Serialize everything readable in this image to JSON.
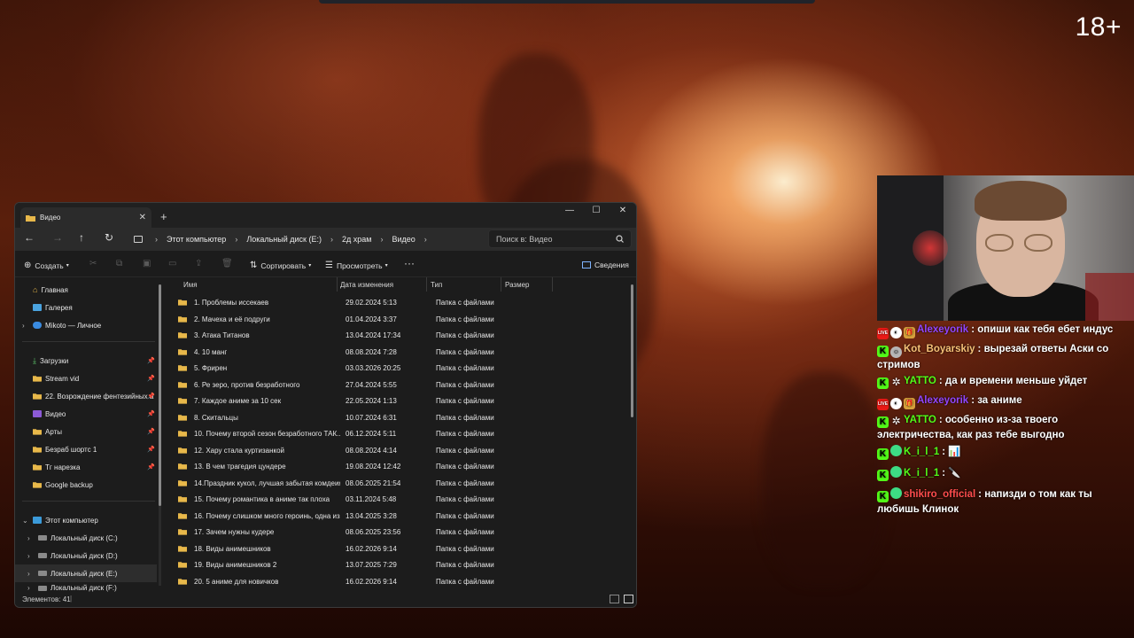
{
  "overlay": {
    "age_rating": "18+"
  },
  "explorer": {
    "tab_title": "Видео",
    "new_tab_symbol": "+",
    "window_controls": {
      "minimize": "—",
      "maximize": "☐",
      "close": "✕"
    },
    "nav": {
      "back": "←",
      "forward": "→",
      "up": "↑",
      "refresh": "↻"
    },
    "breadcrumbs": [
      "Этот компьютер",
      "Локальный диск (E:)",
      "2д храм",
      "Видео"
    ],
    "search_placeholder": "Поиск в: Видео",
    "toolbar": {
      "create": "Создать",
      "sort": "Сортировать",
      "view": "Просмотреть",
      "more": "···",
      "details": "Сведения"
    },
    "sidebar": {
      "quick": [
        "Главная",
        "Галерея",
        "Mikoto — Личное"
      ],
      "pinned": [
        "Загрузки",
        "Stream vid",
        "22. Возрождение фентезийных а",
        "Видео",
        "Арты",
        "Безраб шортс 1",
        "Тг нарезка",
        "Google backup"
      ],
      "this_pc": "Этот компьютер",
      "drives": [
        "Локальный диск (C:)",
        "Локальный диск (D:)",
        "Локальный диск (E:)",
        "Локальный диск (F:)"
      ]
    },
    "columns": {
      "name": "Имя",
      "date": "Дата изменения",
      "type": "Тип",
      "size": "Размер"
    },
    "files": [
      {
        "name": "1. Проблемы иссекаев",
        "date": "29.02.2024 5:13",
        "type": "Папка с файлами"
      },
      {
        "name": "2. Мачеха и её подруги",
        "date": "01.04.2024 3:37",
        "type": "Папка с файлами"
      },
      {
        "name": "3. Атака Титанов",
        "date": "13.04.2024 17:34",
        "type": "Папка с файлами"
      },
      {
        "name": "4. 10 манг",
        "date": "08.08.2024 7:28",
        "type": "Папка с файлами"
      },
      {
        "name": "5. Фрирен",
        "date": "03.03.2026 20:25",
        "type": "Папка с файлами"
      },
      {
        "name": "6. Ре зеро, против безработного",
        "date": "27.04.2024 5:55",
        "type": "Папка с файлами"
      },
      {
        "name": "7. Каждое аниме за 10 сек",
        "date": "22.05.2024 1:13",
        "type": "Папка с файлами"
      },
      {
        "name": "8. Скитальцы",
        "date": "10.07.2024 6:31",
        "type": "Папка с файлами"
      },
      {
        "name": "10. Почему второй сезон безработного ТАК...",
        "date": "06.12.2024 5:11",
        "type": "Папка с файлами"
      },
      {
        "name": "12. Хару стала куртизанкой",
        "date": "08.08.2024 4:14",
        "type": "Папка с файлами"
      },
      {
        "name": "13. В чем трагедия цундере",
        "date": "19.08.2024 12:42",
        "type": "Папка с файлами"
      },
      {
        "name": "14.Праздник кукол, лучшая забытая комдеия",
        "date": "08.06.2025 21:54",
        "type": "Папка с файлами"
      },
      {
        "name": "15. Почему романтика в аниме так плоха",
        "date": "03.11.2024 5:48",
        "type": "Папка с файлами"
      },
      {
        "name": "16. Почему слишком много героинь, одна из...",
        "date": "13.04.2025 3:28",
        "type": "Папка с файлами"
      },
      {
        "name": "17. Зачем нужны кудере",
        "date": "08.06.2025 23:56",
        "type": "Папка с файлами"
      },
      {
        "name": "18. Виды анимешников",
        "date": "16.02.2026 9:14",
        "type": "Папка с файлами"
      },
      {
        "name": "19. Виды анимешников 2",
        "date": "13.07.2025 7:29",
        "type": "Папка с файлами"
      },
      {
        "name": "20. 5 аниме для новичков",
        "date": "16.02.2026 9:14",
        "type": "Папка с файлами"
      }
    ],
    "status": "Элементов: 41"
  },
  "chat": [
    {
      "platform": "live",
      "nick": "Alexeyorik",
      "nick_color": "#9146ff",
      "text": "опиши как тебя ебет индус"
    },
    {
      "platform": "kick",
      "nick": "Kot_Boyarskiy",
      "nick_color": "#f6c177",
      "text": "вырезай ответы Аски со стримов"
    },
    {
      "platform": "kick",
      "nick": "YATTO",
      "nick_color": "#53fc18",
      "text": "да и времени меньше уйдет"
    },
    {
      "platform": "live",
      "nick": "Alexeyorik",
      "nick_color": "#9146ff",
      "text": "за аниме"
    },
    {
      "platform": "kick",
      "nick": "YATTO",
      "nick_color": "#53fc18",
      "text": "особенно из-за твоего электричества, как раз тебе выгодно"
    },
    {
      "platform": "kick",
      "nick": "K_i_l_1",
      "nick_color": "#53fc18",
      "text": "📊"
    },
    {
      "platform": "kick",
      "nick": "K_i_l_1",
      "nick_color": "#53fc18",
      "text": "🔪"
    },
    {
      "platform": "kick",
      "nick": "shikiro_official",
      "nick_color": "#ff4d4d",
      "text": "напизди о том как ты любишь Клинок"
    }
  ]
}
